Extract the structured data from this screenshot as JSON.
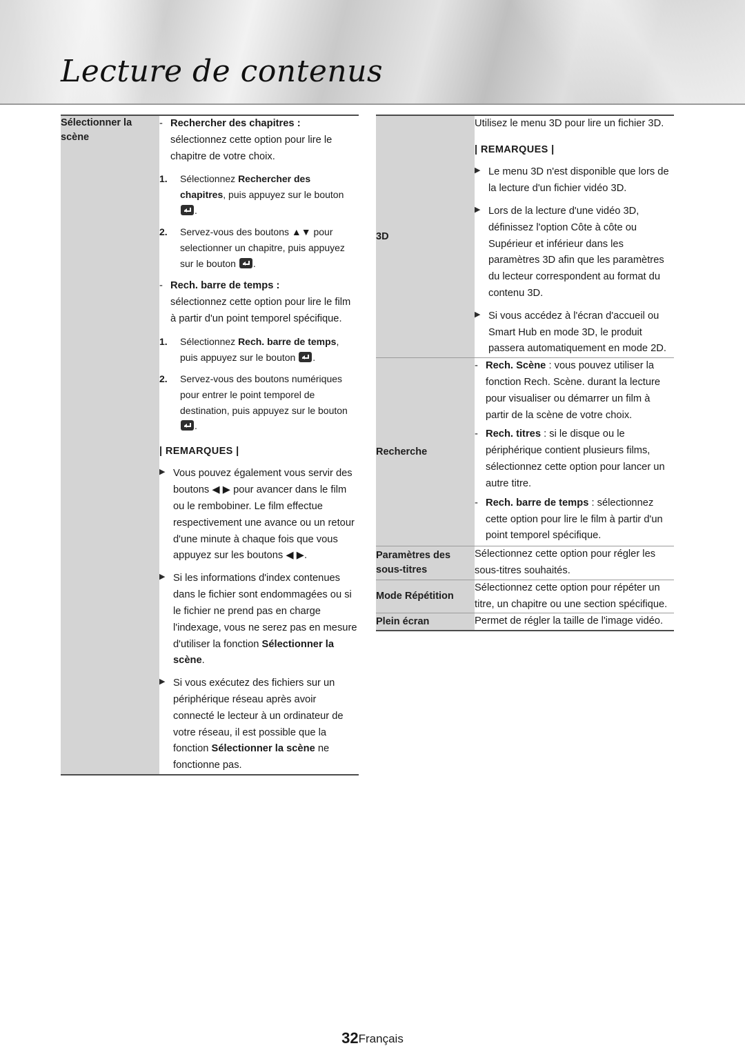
{
  "header": {
    "title": "Lecture de contenus"
  },
  "footer": {
    "page_number": "32",
    "language": "Français"
  },
  "left_table": {
    "label": "Sélectionner la scène",
    "items": [
      {
        "dash_title": "Rechercher des chapitres",
        "dash_colon": " :",
        "dash_desc": "sélectionnez cette option pour lire le chapitre de votre choix.",
        "steps": [
          {
            "num": "1.",
            "pre": "Sélectionnez ",
            "bold": "Rechercher des chapitres",
            "post": ", puis appuyez sur le bouton ",
            "tail": "."
          },
          {
            "num": "2.",
            "pre": "Servez-vous des boutons ",
            "arrows": "▲▼",
            "post": " pour selectionner un chapitre, puis appuyez sur le bouton ",
            "tail": "."
          }
        ]
      },
      {
        "dash_title": "Rech. barre de temps",
        "dash_colon": " :",
        "dash_desc": "sélectionnez cette option pour lire le film à partir d'un point temporel spécifique.",
        "steps": [
          {
            "num": "1.",
            "pre": "Sélectionnez ",
            "bold": "Rech. barre de temps",
            "post": ", puis appuyez sur le bouton ",
            "tail": "."
          },
          {
            "num": "2.",
            "pre": "Servez-vous des boutons numériques pour entrer le point temporel de destination, puis appuyez sur le bouton ",
            "arrows": "",
            "post": "",
            "tail": "."
          }
        ]
      }
    ],
    "remarks_label": "| REMARQUES |",
    "remarks": [
      {
        "parts": [
          {
            "t": "Vous pouvez également vous servir des boutons ",
            "b": false
          },
          {
            "t": "◀ ▶",
            "b": false
          },
          {
            "t": " pour avancer dans le film ou le rembobiner. Le film effectue respectivement une avance ou un retour d'une minute à chaque fois que vous appuyez sur les boutons ",
            "b": false
          },
          {
            "t": "◀ ▶",
            "b": false
          },
          {
            "t": ".",
            "b": false
          }
        ]
      },
      {
        "parts": [
          {
            "t": "Si les informations d'index contenues dans le fichier sont endommagées ou si le fichier ne prend pas en charge l'indexage, vous ne serez pas en mesure d'utiliser la fonction ",
            "b": false
          },
          {
            "t": "Sélectionner la scène",
            "b": true
          },
          {
            "t": ".",
            "b": false
          }
        ]
      },
      {
        "parts": [
          {
            "t": "Si vous exécutez des fichiers sur un périphérique réseau après avoir connecté le lecteur à un ordinateur de votre réseau, il est possible que la fonction ",
            "b": false
          },
          {
            "t": "Sélectionner la scène",
            "b": true
          },
          {
            "t": " ne fonctionne pas.",
            "b": false
          }
        ]
      }
    ]
  },
  "right_table": {
    "rows": [
      {
        "label": "3D",
        "intro": "Utilisez le menu 3D pour lire un fichier 3D.",
        "remarks_label": "| REMARQUES |",
        "remarks": [
          "Le menu 3D n'est disponible que lors de la lecture d'un fichier vidéo 3D.",
          "Lors de la lecture d'une vidéo 3D, définissez l'option Côte à côte ou Supérieur et inférieur dans les paramètres 3D afin que les paramètres du lecteur correspondent au format du contenu 3D.",
          "Si vous accédez à l'écran d'accueil ou Smart Hub en mode 3D, le produit passera automatiquement en mode 2D."
        ]
      },
      {
        "label": "Recherche",
        "items": [
          {
            "bold": "Rech. Scène",
            "rest": " : vous pouvez utiliser la fonction Rech. Scène. durant la lecture pour visualiser ou démarrer un film à partir de la scène de votre choix."
          },
          {
            "bold": "Rech. titres",
            "rest": " : si le disque ou le périphérique contient plusieurs films, sélectionnez cette option pour lancer un autre titre."
          },
          {
            "bold": "Rech. barre de temps",
            "rest": " : sélectionnez cette option pour lire le film à partir d'un point temporel spécifique."
          }
        ]
      },
      {
        "label": "Paramètres des sous-titres",
        "text": "Sélectionnez cette option pour régler les sous-titres souhaités."
      },
      {
        "label": "Mode Répétition",
        "text": "Sélectionnez cette option pour répéter un titre, un chapitre ou une section spécifique."
      },
      {
        "label": "Plein écran",
        "text": "Permet de régler la taille de l'image vidéo."
      }
    ]
  }
}
